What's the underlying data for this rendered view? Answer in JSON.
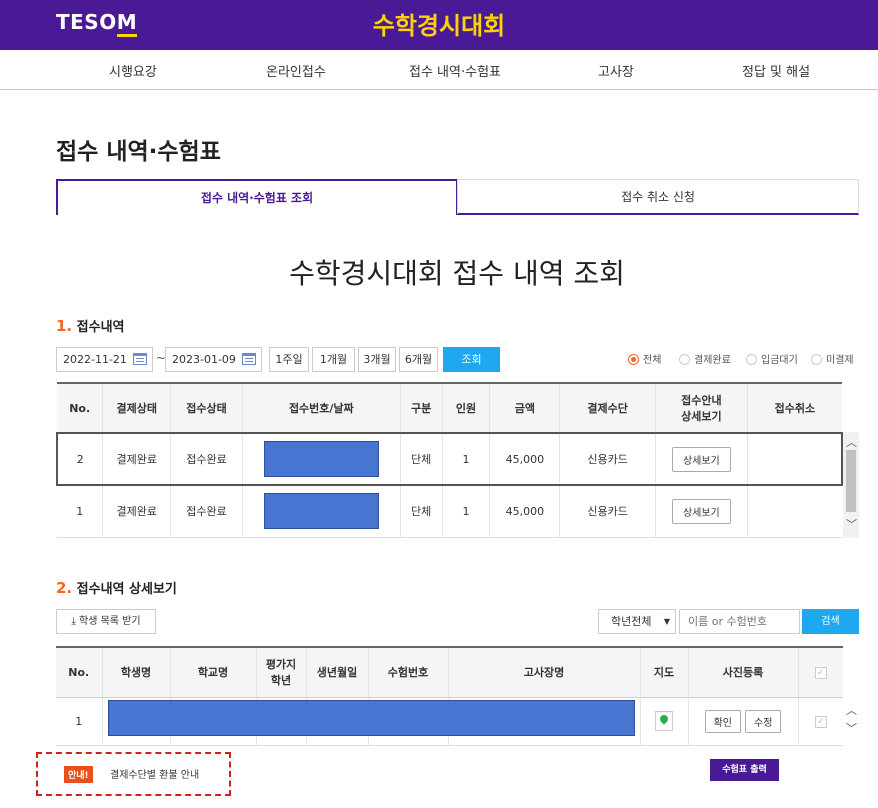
{
  "header": {
    "logo": "TESO",
    "logo_m": "M",
    "site_title": "수학경시대회"
  },
  "nav": [
    "시행요강",
    "온라인접수",
    "접수 내역·수험표",
    "고사장",
    "정답 및 해설"
  ],
  "page_title": "접수 내역·수험표",
  "tabs": [
    "접수 내역·수험표 조회",
    "접수 취소 신청"
  ],
  "main_heading": "수학경시대회 접수 내역 조회",
  "section1": {
    "num": "1.",
    "title": "접수내역",
    "date_from": "2022-11-21",
    "date_to": "2023-01-09",
    "dash": "~",
    "periods": [
      "1주일",
      "1개월",
      "3개월",
      "6개월"
    ],
    "search": "조회",
    "filters": [
      "전체",
      "결제완료",
      "입금대기",
      "미결제"
    ],
    "filter_selected": "전체",
    "columns": [
      "No.",
      "결제상태",
      "접수상태",
      "접수번호/날짜",
      "구분",
      "인원",
      "금액",
      "결제수단",
      "접수안내\n상세보기",
      "접수취소"
    ],
    "rows": [
      {
        "no": "2",
        "pay_status": "결제완료",
        "reg_status": "접수완료",
        "type": "단체",
        "count": "1",
        "amount": "45,000",
        "method": "신용카드",
        "detail": "상세보기"
      },
      {
        "no": "1",
        "pay_status": "결제완료",
        "reg_status": "접수완료",
        "type": "단체",
        "count": "1",
        "amount": "45,000",
        "method": "신용카드",
        "detail": "상세보기"
      }
    ]
  },
  "section2": {
    "num": "2.",
    "title": "접수내역 상세보기",
    "download": "학생 목록 받기",
    "grade_select": "학년전체",
    "search_placeholder": "이름 or 수험번호",
    "search": "검색",
    "columns": [
      "No.",
      "학생명",
      "학교명",
      "평가지\n학년",
      "생년월일",
      "수험번호",
      "고사장명",
      "지도",
      "사진등록"
    ],
    "rows": [
      {
        "no": "1",
        "confirm": "확인",
        "edit": "수정"
      }
    ]
  },
  "notice": {
    "tag": "안내!",
    "text": "결제수단별 환불 안내"
  },
  "print_button": "수험표 출력"
}
